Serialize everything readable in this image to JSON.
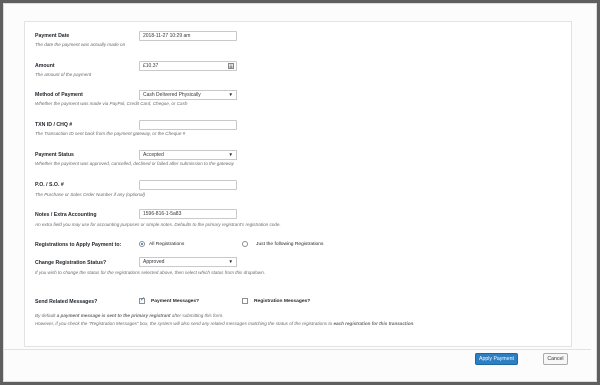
{
  "form": {
    "payment_date": {
      "label": "Payment Date",
      "value": "2018-11-27 10:29 am",
      "help": "The date the payment was actually made on"
    },
    "amount": {
      "label": "Amount",
      "value": "£10.37",
      "help": "The amount of the payment"
    },
    "method": {
      "label": "Method of Payment",
      "value": "Cash Delivered Physically",
      "help": "Whether the payment was made via PayPal, Credit Card, Cheque, or Cash"
    },
    "txn_id": {
      "label": "TXN ID / CHQ #",
      "value": "",
      "help": "The Transaction ID sent back from the payment gateway, or the Cheque #"
    },
    "status": {
      "label": "Payment Status",
      "value": "Accepted",
      "help": "Whether the payment was approved, cancelled, declined or failed after submission to the gateway"
    },
    "po": {
      "label": "P.O. / S.O. #",
      "value": "",
      "help": "The Purchase or Sales Order Number if any (optional)"
    },
    "notes": {
      "label": "Notes / Extra Accounting",
      "value": "1596-816-1-5a83",
      "help": "An extra field you may use for accounting purposes or simple notes. Defaults to the primary registrant's registration code."
    },
    "registrations": {
      "label": "Registrations to Apply Payment to:",
      "option_all": "All Registrations",
      "option_following": "Just the following Registrations"
    },
    "change_status": {
      "label": "Change Registration Status?",
      "value": "Approved",
      "help": "If you wish to change the status for the registrations selected above, then select which status from this dropdown."
    },
    "send_messages": {
      "label": "Send Related Messages?",
      "payment_messages": "Payment Messages?",
      "registration_messages": "Registration Messages?",
      "info_1a": "By default ",
      "info_1b": "a payment message is sent to the primary registrant",
      "info_1c": " after submitting this form.",
      "info_2a": "However, if you check the \"Registration Messages\" box, the system will also send any related messages matching the status of the registrations to ",
      "info_2b": "each registration for this transaction",
      "info_2c": "."
    }
  },
  "footer": {
    "apply_label": "Apply Payment",
    "cancel_label": "Cancel"
  }
}
